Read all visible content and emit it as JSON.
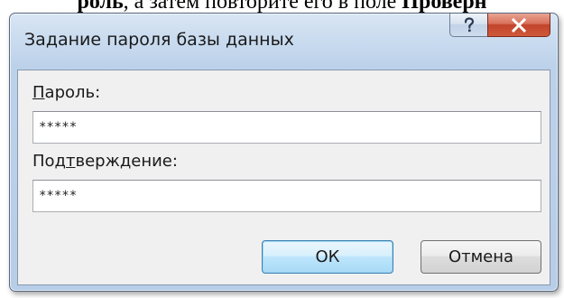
{
  "background": {
    "text_prefix": "роль",
    "text_middle": ", а затем повторите его в поле ",
    "text_bold_end": "Проверн"
  },
  "dialog": {
    "title": "Задание пароля базы данных",
    "help_button_icon": "question-icon",
    "close_button_icon": "close-x-icon",
    "password": {
      "label_accel": "П",
      "label_rest": "ароль:",
      "value": "*****"
    },
    "confirm": {
      "label_before": "Под",
      "label_accel": "т",
      "label_rest": "верждение:",
      "value": "*****"
    },
    "ok_label": "ОК",
    "cancel_label": "Отмена"
  },
  "colors": {
    "frame": "#b7cde8",
    "close_button": "#c2432c",
    "ok_border": "#3c7fb1",
    "client_bg": "#f0f0f0"
  }
}
